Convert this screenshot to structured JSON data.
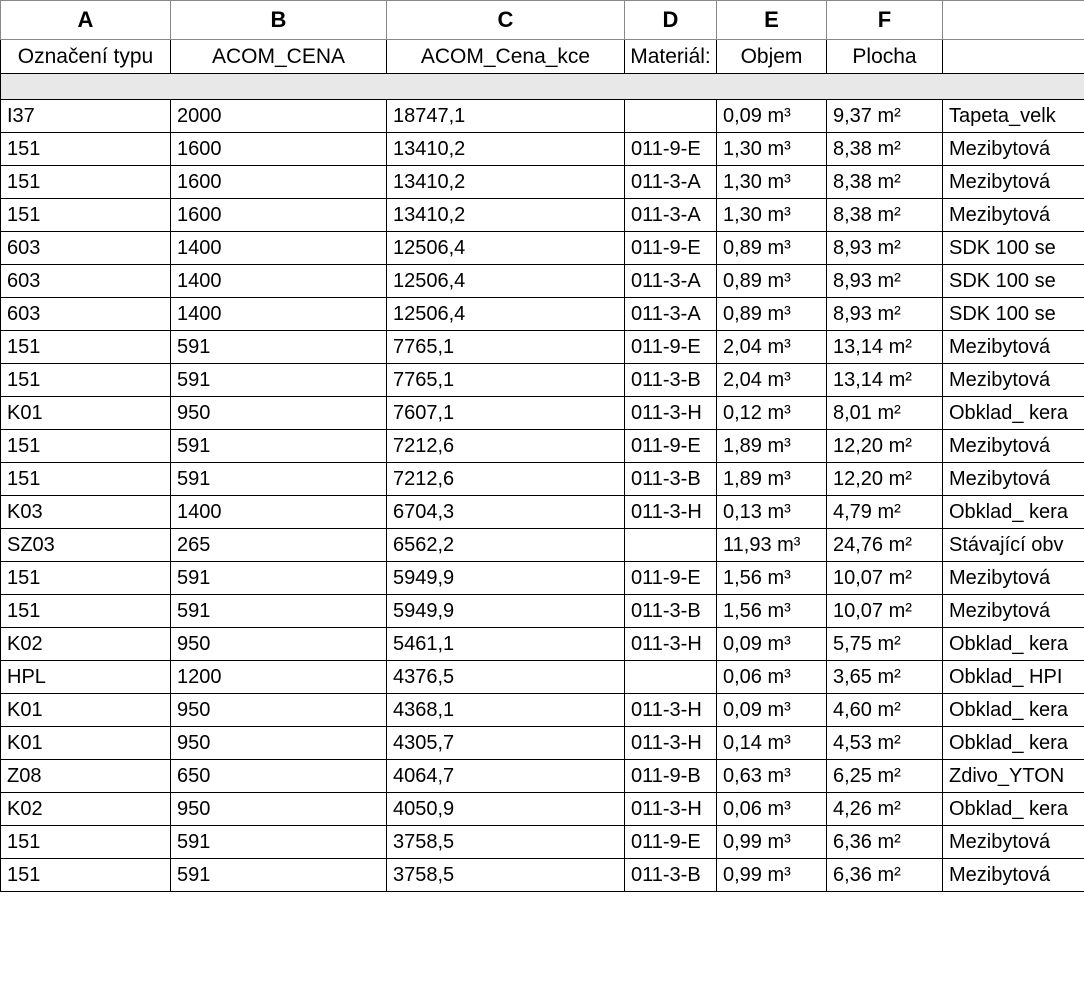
{
  "columns": [
    "A",
    "B",
    "C",
    "D",
    "E",
    "F",
    ""
  ],
  "headers": [
    "Označení typu",
    "ACOM_CENA",
    "ACOM_Cena_kce",
    "Materiál:",
    "Objem",
    "Plocha",
    ""
  ],
  "rows": [
    {
      "a": "I37",
      "b": "2000",
      "c": "18747,1",
      "d": "",
      "e": "0,09 m³",
      "f": "9,37 m²",
      "g": "Tapeta_velk"
    },
    {
      "a": "151",
      "b": "1600",
      "c": "13410,2",
      "d": "011-9-E",
      "e": "1,30 m³",
      "f": "8,38 m²",
      "g": "Mezibytová"
    },
    {
      "a": "151",
      "b": "1600",
      "c": "13410,2",
      "d": "011-3-A",
      "e": "1,30 m³",
      "f": "8,38 m²",
      "g": "Mezibytová"
    },
    {
      "a": "151",
      "b": "1600",
      "c": "13410,2",
      "d": "011-3-A",
      "e": "1,30 m³",
      "f": "8,38 m²",
      "g": "Mezibytová"
    },
    {
      "a": "603",
      "b": "1400",
      "c": "12506,4",
      "d": "011-9-E",
      "e": "0,89 m³",
      "f": "8,93 m²",
      "g": "SDK 100 se"
    },
    {
      "a": "603",
      "b": "1400",
      "c": "12506,4",
      "d": "011-3-A",
      "e": "0,89 m³",
      "f": "8,93 m²",
      "g": "SDK 100 se"
    },
    {
      "a": "603",
      "b": "1400",
      "c": "12506,4",
      "d": "011-3-A",
      "e": "0,89 m³",
      "f": "8,93 m²",
      "g": "SDK 100 se"
    },
    {
      "a": "151",
      "b": "591",
      "c": "7765,1",
      "d": "011-9-E",
      "e": "2,04 m³",
      "f": "13,14 m²",
      "g": "Mezibytová"
    },
    {
      "a": "151",
      "b": "591",
      "c": "7765,1",
      "d": "011-3-B",
      "e": "2,04 m³",
      "f": "13,14 m²",
      "g": "Mezibytová"
    },
    {
      "a": "K01",
      "b": "950",
      "c": "7607,1",
      "d": "011-3-H",
      "e": "0,12 m³",
      "f": "8,01 m²",
      "g": "Obklad_ kera"
    },
    {
      "a": "151",
      "b": "591",
      "c": "7212,6",
      "d": "011-9-E",
      "e": "1,89 m³",
      "f": "12,20 m²",
      "g": "Mezibytová"
    },
    {
      "a": "151",
      "b": "591",
      "c": "7212,6",
      "d": "011-3-B",
      "e": "1,89 m³",
      "f": "12,20 m²",
      "g": "Mezibytová"
    },
    {
      "a": "K03",
      "b": "1400",
      "c": "6704,3",
      "d": "011-3-H",
      "e": "0,13 m³",
      "f": "4,79 m²",
      "g": "Obklad_ kera"
    },
    {
      "a": "SZ03",
      "b": "265",
      "c": "6562,2",
      "d": "",
      "e": "11,93 m³",
      "f": "24,76 m²",
      "g": "Stávající obv"
    },
    {
      "a": "151",
      "b": "591",
      "c": "5949,9",
      "d": "011-9-E",
      "e": "1,56 m³",
      "f": "10,07 m²",
      "g": "Mezibytová"
    },
    {
      "a": "151",
      "b": "591",
      "c": "5949,9",
      "d": "011-3-B",
      "e": "1,56 m³",
      "f": "10,07 m²",
      "g": "Mezibytová"
    },
    {
      "a": "K02",
      "b": "950",
      "c": "5461,1",
      "d": "011-3-H",
      "e": "0,09 m³",
      "f": "5,75 m²",
      "g": "Obklad_ kera"
    },
    {
      "a": "HPL",
      "b": "1200",
      "c": "4376,5",
      "d": "",
      "e": "0,06 m³",
      "f": "3,65 m²",
      "g": "Obklad_ HPI"
    },
    {
      "a": "K01",
      "b": "950",
      "c": "4368,1",
      "d": "011-3-H",
      "e": "0,09 m³",
      "f": "4,60 m²",
      "g": "Obklad_ kera"
    },
    {
      "a": "K01",
      "b": "950",
      "c": "4305,7",
      "d": "011-3-H",
      "e": "0,14 m³",
      "f": "4,53 m²",
      "g": "Obklad_ kera"
    },
    {
      "a": "Z08",
      "b": "650",
      "c": "4064,7",
      "d": "011-9-B",
      "e": "0,63 m³",
      "f": "6,25 m²",
      "g": "Zdivo_YTON"
    },
    {
      "a": "K02",
      "b": "950",
      "c": "4050,9",
      "d": "011-3-H",
      "e": "0,06 m³",
      "f": "4,26 m²",
      "g": "Obklad_ kera"
    },
    {
      "a": "151",
      "b": "591",
      "c": "3758,5",
      "d": "011-9-E",
      "e": "0,99 m³",
      "f": "6,36 m²",
      "g": "Mezibytová"
    },
    {
      "a": "151",
      "b": "591",
      "c": "3758,5",
      "d": "011-3-B",
      "e": "0,99 m³",
      "f": "6,36 m²",
      "g": "Mezibytová"
    }
  ]
}
